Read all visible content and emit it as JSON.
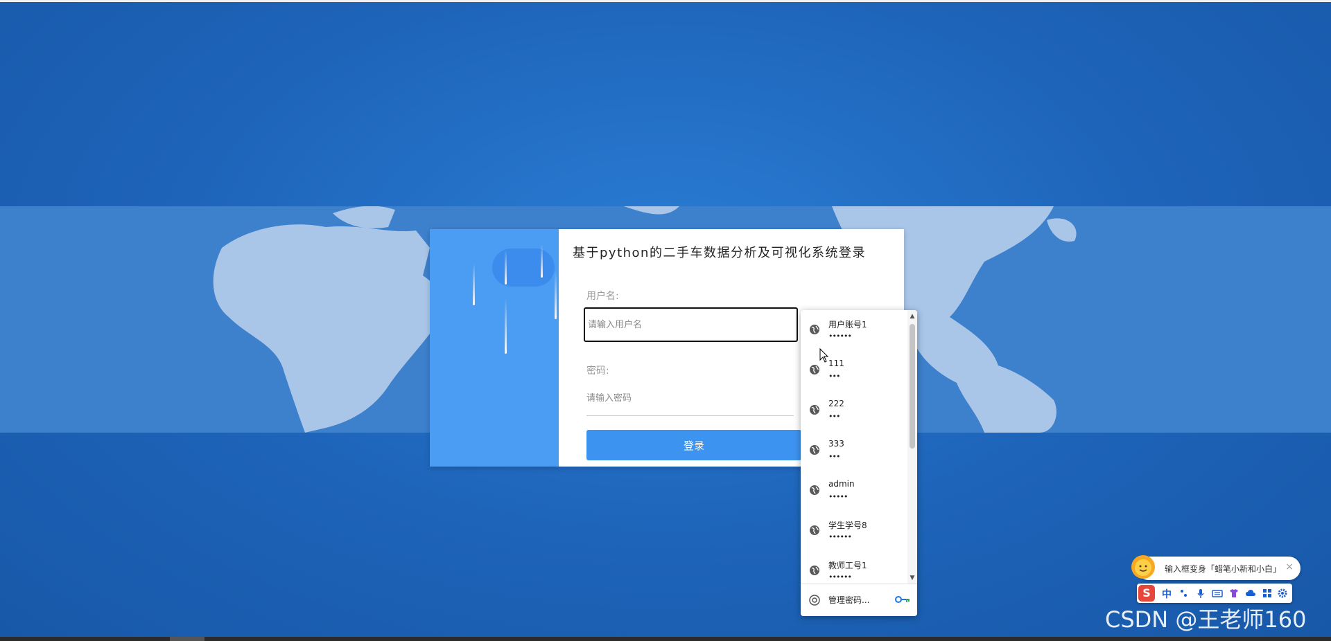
{
  "login": {
    "title": "基于python的二手车数据分析及可视化系统登录",
    "username_label": "用户名:",
    "username_placeholder": "请输入用户名",
    "password_label": "密码:",
    "password_placeholder": "请输入密码",
    "submit_label": "登录"
  },
  "password_dropdown": {
    "items": [
      {
        "username": "用户账号1",
        "password_mask": "••••••"
      },
      {
        "username": "111",
        "password_mask": "•••"
      },
      {
        "username": "222",
        "password_mask": "•••"
      },
      {
        "username": "333",
        "password_mask": "•••"
      },
      {
        "username": "admin",
        "password_mask": "•••••"
      },
      {
        "username": "学生学号8",
        "password_mask": "••••••"
      },
      {
        "username": "教师工号1",
        "password_mask": "••••••"
      }
    ],
    "manage_label": "管理密码..."
  },
  "ime": {
    "tip_text": "输入框变身「蜡笔小新和小白」",
    "close": "×",
    "logo": "S",
    "mode": "中",
    "icons": [
      "punctuation-icon",
      "microphone-icon",
      "keyboard-icon",
      "skin-icon",
      "cloud-icon",
      "grid-icon",
      "settings-icon"
    ]
  },
  "watermark": "CSDN @王老师160",
  "colors": {
    "background": "#1d63b8",
    "map_band": "#3d80cc",
    "accent": "#3d94f0",
    "login_left": "#4a9df2"
  }
}
